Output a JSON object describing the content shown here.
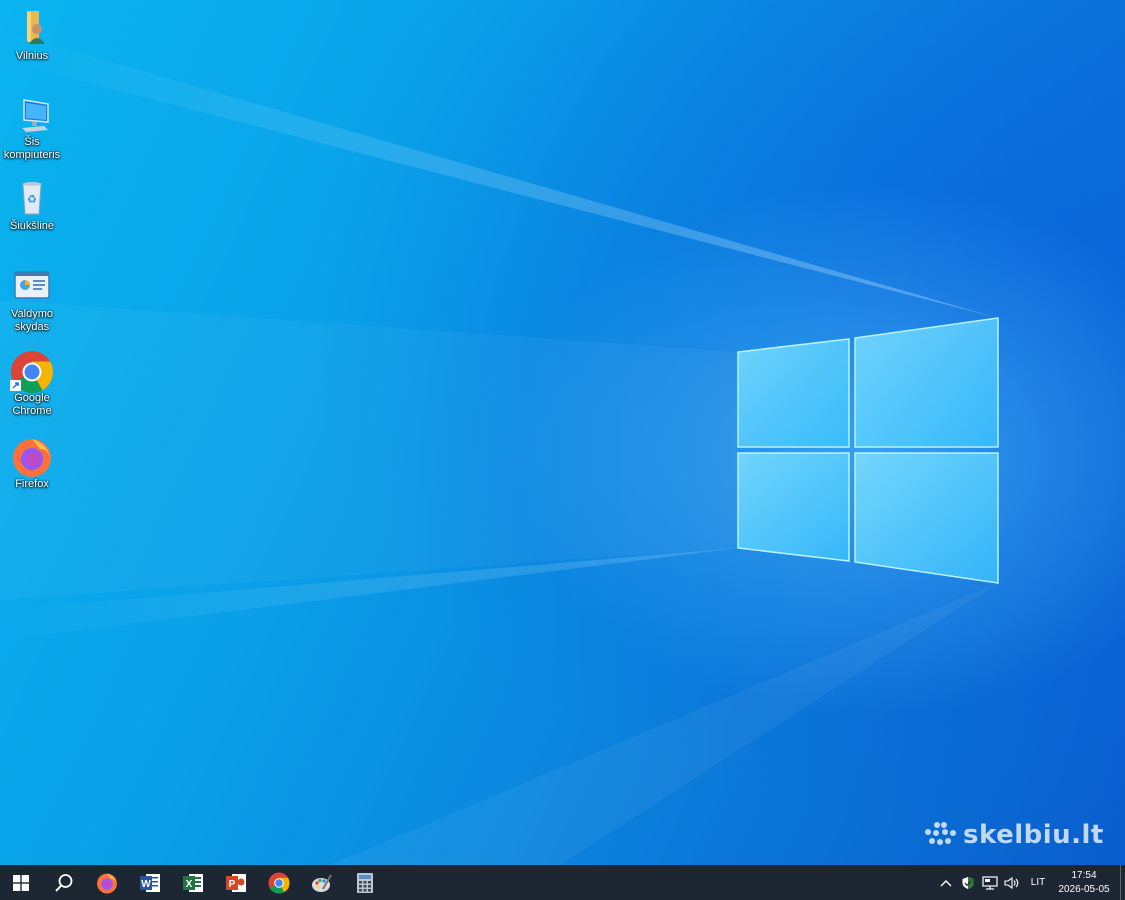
{
  "desktop": {
    "icons": [
      {
        "label": "Vilnius",
        "icon": "user-folder-icon"
      },
      {
        "label": "Šis kompiuteris",
        "icon": "computer-icon"
      },
      {
        "label": "Šiukšlinė",
        "icon": "recycle-bin-icon"
      },
      {
        "label": "Valdymo skydas",
        "icon": "control-panel-icon"
      },
      {
        "label": "Google Chrome",
        "icon": "chrome-icon"
      },
      {
        "label": "Firefox",
        "icon": "firefox-icon"
      }
    ]
  },
  "watermark": {
    "text": "skelbiu.lt"
  },
  "taskbar": {
    "apps": [
      "start-icon",
      "search-icon",
      "firefox-icon",
      "word-icon",
      "excel-icon",
      "powerpoint-icon",
      "chrome-icon",
      "paint-icon",
      "calculator-icon"
    ],
    "tray": {
      "language": "LIT",
      "time": "17:54",
      "date": "2026-05-05"
    }
  },
  "colors": {
    "taskbar": "#1c2733",
    "wallpaper_accent": "#0a9fe8"
  }
}
